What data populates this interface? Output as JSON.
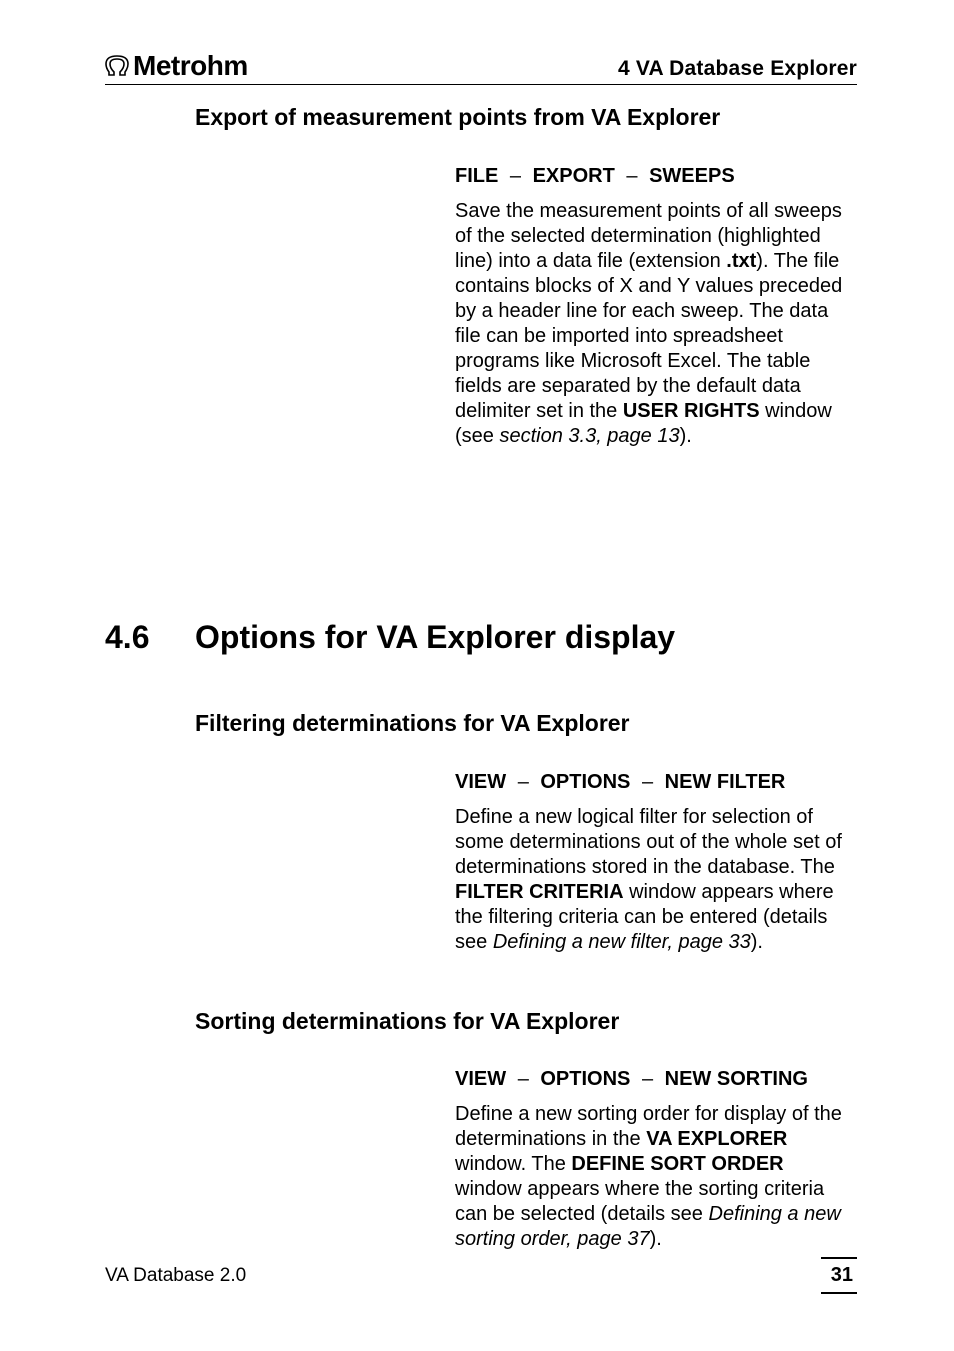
{
  "header": {
    "brand": "Metrohm",
    "chapter": "4  VA Database Explorer"
  },
  "section1": {
    "subhead": "Export of measurement points from VA Explorer",
    "menu": {
      "a": "FILE",
      "b": "EXPORT",
      "c": "SWEEPS"
    },
    "para_parts": {
      "p1": "Save the measurement points of all sweeps of the selected determination (highlighted line) into a data file (extension ",
      "ext": ".txt",
      "p2": "). The file contains blocks of X and Y values preceded by a header line for each sweep. The data file can be imported into spreadsheet programs like Microsoft Excel. The table fields are separated by the default data delimiter set in the ",
      "win": "USER RIGHTS",
      "p3": " window (see ",
      "ref": "section 3.3, page 13",
      "p4": ")."
    }
  },
  "bighead": {
    "num": "4.6",
    "title": "Options for VA Explorer display"
  },
  "section2": {
    "subhead": "Filtering determinations for VA Explorer",
    "menu": {
      "a": "VIEW",
      "b": "OPTIONS",
      "c": "NEW FILTER"
    },
    "para_parts": {
      "p1": "Define a new logical filter for selection of some determinations out of the whole set of determinations stored in the database. The ",
      "win": "FILTER CRITERIA",
      "p2": " window appears where the filtering criteria can be entered (details see ",
      "ref": "Defining a new filter, page 33",
      "p3": ")."
    }
  },
  "section3": {
    "subhead": "Sorting determinations for VA Explorer",
    "menu": {
      "a": "VIEW",
      "b": "OPTIONS",
      "c": "NEW SORTING"
    },
    "para_parts": {
      "p1": "Define a new sorting order for display of the determinations in the ",
      "winA": "VA EXPLORER",
      "p2": " window. The ",
      "winB": "DEFINE SORT ORDER",
      "p3": " window appears where the sorting criteria can be selected (details see ",
      "ref": "Defining a new sorting order, page 37",
      "p4": ")."
    }
  },
  "footer": {
    "product": "VA Database 2.0",
    "page": "31"
  }
}
